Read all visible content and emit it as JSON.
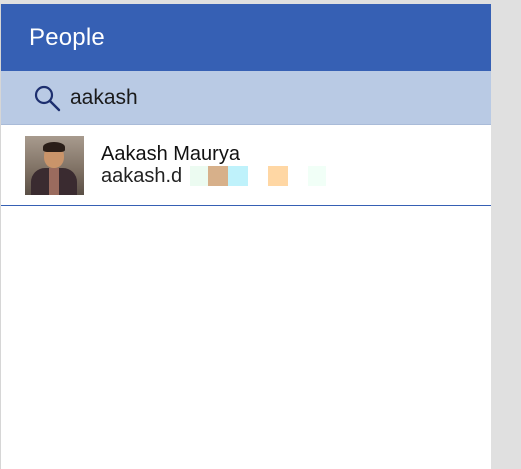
{
  "header": {
    "title": "People"
  },
  "search": {
    "value": "aakash",
    "icon": "search-icon"
  },
  "results": [
    {
      "name": "Aakash Maurya",
      "email": "aakash.d"
    }
  ],
  "colors": {
    "header_bg": "#3660b4",
    "search_bg": "#b9cae4",
    "divider": "#3660b4"
  }
}
